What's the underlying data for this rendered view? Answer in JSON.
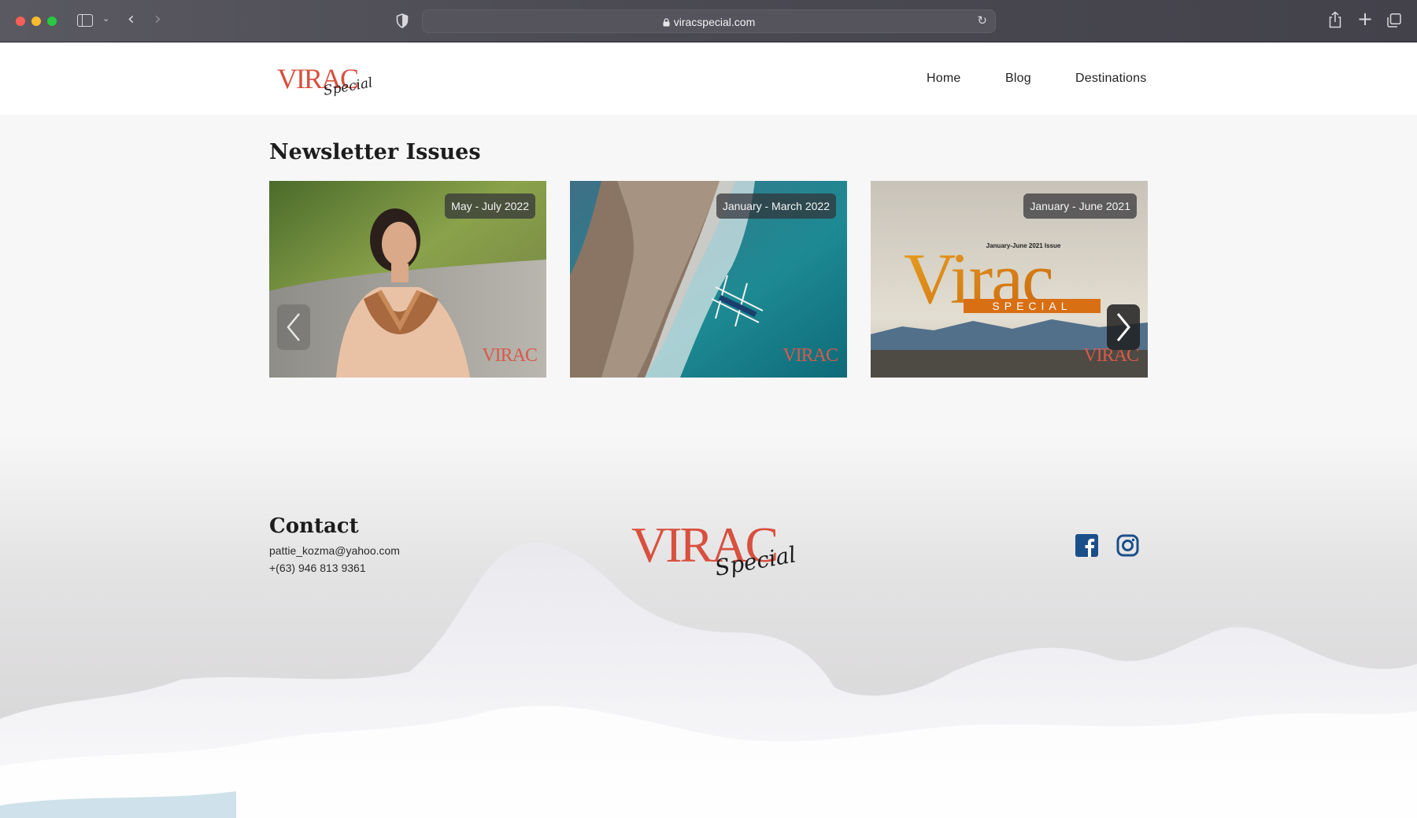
{
  "browser": {
    "url": "viracspecial.com"
  },
  "header": {
    "logo_text": "VIRAC",
    "logo_script": "Special",
    "nav": {
      "home": "Home",
      "blog": "Blog",
      "destinations": "Destinations"
    }
  },
  "newsletter": {
    "title": "Newsletter Issues",
    "issues": [
      {
        "label": "May - July 2022",
        "watermark": "VIRAC"
      },
      {
        "label": "January - March 2022",
        "watermark": "VIRAC"
      },
      {
        "label": "January - June 2021",
        "watermark": "VIRAC",
        "cover_title": "Virac",
        "cover_subtitle": "SPECIAL",
        "cover_issue": "January-June 2021 Issue"
      }
    ]
  },
  "footer": {
    "contact_title": "Contact",
    "email": "pattie_kozma@yahoo.com",
    "phone": "+(63) 946 813 9361",
    "logo_text": "VIRAC",
    "logo_script": "Special"
  },
  "colors": {
    "brand_red": "#d8503f",
    "facebook_blue": "#1b4f8a",
    "instagram_blue": "#1b4f8a"
  }
}
